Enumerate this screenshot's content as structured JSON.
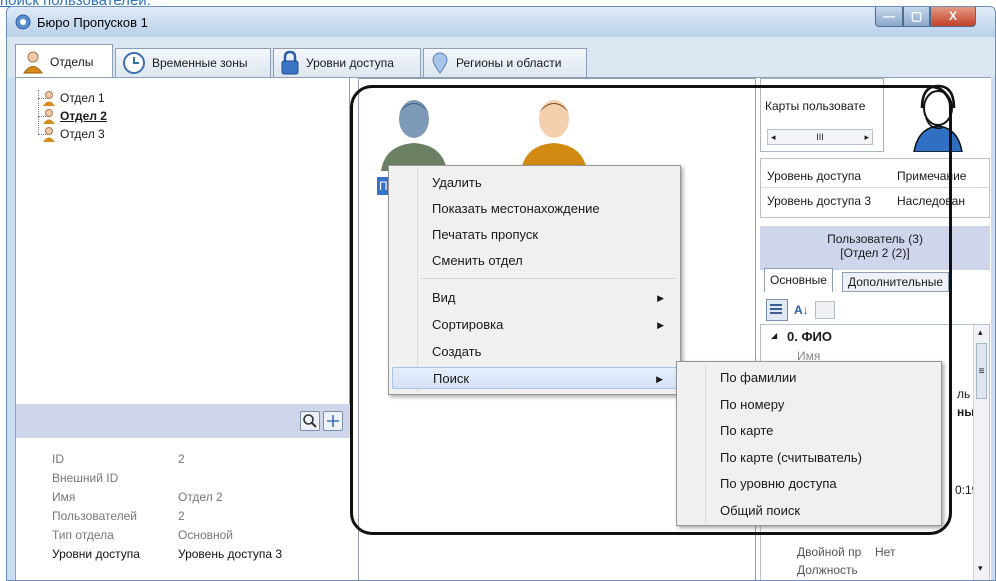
{
  "top_link": "поиск пользователей.",
  "window": {
    "title": "Бюро Пропусков 1",
    "minimize_glyph": "—",
    "maximize_glyph": "▢",
    "close_glyph": "X"
  },
  "tabs": [
    {
      "label": "Отделы",
      "icon": "person-icon"
    },
    {
      "label": "Временные зоны",
      "icon": "clock-icon"
    },
    {
      "label": "Уровни доступа",
      "icon": "lock-icon"
    },
    {
      "label": "Регионы и области",
      "icon": "location-pin-icon"
    }
  ],
  "tree": {
    "items": [
      {
        "label": "Отдел 1"
      },
      {
        "label": "Отдел 2",
        "selected": true
      },
      {
        "label": "Отдел 3"
      }
    ]
  },
  "properties": [
    {
      "key": "ID",
      "value": "2"
    },
    {
      "key": "Внешний ID",
      "value": ""
    },
    {
      "key": "Имя",
      "value": "Отдел 2"
    },
    {
      "key": "Пользователей",
      "value": "2"
    },
    {
      "key": "Тип отдела",
      "value": "Основной"
    },
    {
      "key": "Уровни доступа",
      "value": "Уровень доступа 3"
    }
  ],
  "user_tile_label": "По",
  "context_menu": {
    "items": [
      "Удалить",
      "Показать местонахождение",
      "Печатать пропуск",
      "Сменить отдел",
      "Вид",
      "Сортировка",
      "Создать",
      "Поиск"
    ],
    "arrow_glyph": "▶"
  },
  "search_submenu": {
    "items": [
      "По фамилии",
      "По номеру",
      "По карте",
      "По карте (считыватель)",
      "По уровню доступа",
      "Общий поиск"
    ]
  },
  "right_panel": {
    "cards_header": "Карты пользовате",
    "scroll_left": "◂",
    "scroll_mid": "III",
    "scroll_right": "▸",
    "access_table": {
      "headers": [
        "Уровень доступа",
        "Примечание"
      ],
      "rows": [
        [
          "Уровень доступа 3",
          "Наследован"
        ]
      ]
    },
    "user_caption_1": "Пользователь (3)",
    "user_caption_2": "[Отдел 2 (2)]",
    "subtabs": [
      "Основные",
      "Дополнительные"
    ],
    "sort_glyph": "A↓",
    "section_title": "0. ФИО",
    "section_arrow": "◢",
    "field_name": "Имя",
    "hidden_fragment_1": "ль",
    "hidden_fragment_2": "ные",
    "hidden_fragment_3": "0:19",
    "double_pass_label": "Двойной пр",
    "double_pass_value": "Нет",
    "position_label": "Должность",
    "scroll_up": "▴",
    "scroll_down": "▾",
    "scroll_grip": "≡"
  }
}
